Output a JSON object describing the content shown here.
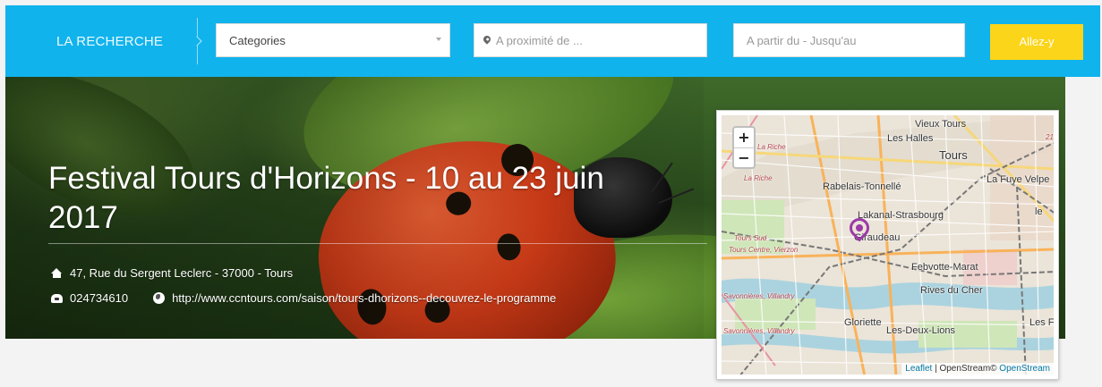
{
  "search": {
    "brand": "LA RECHERCHE",
    "categories_value": "Categories",
    "location_placeholder": "A proximité de ...",
    "dates_placeholder": "A partir du - Jusqu'au",
    "submit_label": "Allez-y"
  },
  "event": {
    "title": "Festival Tours d'Horizons - 10 au 23 juin 2017",
    "address": "47, Rue du Sergent Leclerc - 37000 - Tours",
    "phone": "024734610",
    "website": "http://www.ccntours.com/saison/tours-dhorizons--decouvrez-le-programme"
  },
  "map": {
    "zoom_in": "+",
    "zoom_out": "−",
    "labels": {
      "vieux_tours": "Vieux Tours",
      "les_halles": "Les Halles",
      "tours": "Tours",
      "la_riche_1": "La Riche",
      "la_riche_2": "La Riche",
      "rabelais": "Rabelais-Tonnellé",
      "la_fuye": "La Fuye Velpe",
      "lakanal": "Lakanal-Strasbourg",
      "giraudeau": "Giraudeau",
      "tours_sud": "Tours Sud",
      "tours_centre": "Tours Centre, Vierzon",
      "febvotte": "Febvotte-Marat",
      "rives_du_cher": "Rives du Cher",
      "savonnieres_1": "Savonnières, Villandry",
      "savonnieres_2": "Savonnières, Villandry",
      "gloriette": "Gloriette",
      "les_deux_lions": "Les-Deux-Lions",
      "les_fo": "Les Fo",
      "le": "le",
      "num_21": "21"
    },
    "attribution": {
      "leaflet": "Leaflet",
      "separator": " | OpenStream© ",
      "osm": "OpenStream"
    }
  },
  "colors": {
    "search_bar": "#11b3ec",
    "submit_button": "#fbd51a",
    "marker": "#9b3aa8"
  }
}
